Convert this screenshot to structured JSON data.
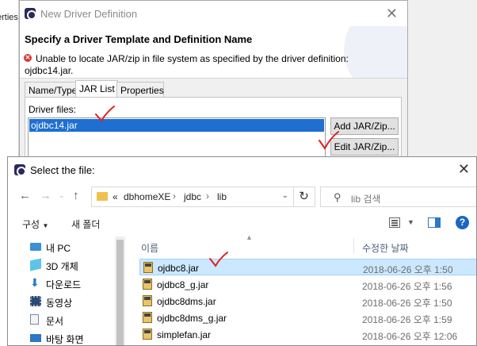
{
  "background": {
    "partial_text": "erties"
  },
  "driver_dialog": {
    "title": "New Driver Definition",
    "heading": "Specify a Driver Template and Definition Name",
    "error_line1": "Unable to locate JAR/zip in file system as specified by the driver definition:",
    "error_line2": "ojdbc14.jar.",
    "tabs": [
      {
        "label": "Name/Type"
      },
      {
        "label": "JAR List"
      },
      {
        "label": "Properties"
      }
    ],
    "driver_files_label": "Driver files:",
    "driver_files": [
      "ojdbc14.jar"
    ],
    "buttons": {
      "add": "Add JAR/Zip...",
      "edit": "Edit JAR/Zip..."
    }
  },
  "file_dialog": {
    "title": "Select the file:",
    "address": {
      "overflow": "«",
      "crumbs": [
        "dbhomeXE",
        "jdbc",
        "lib"
      ]
    },
    "search_placeholder": "lib 검색",
    "commands": {
      "organize": "구성",
      "new_folder": "새 폴더"
    },
    "nav_items": [
      {
        "label": "내 PC",
        "icon": "pc-icon"
      },
      {
        "label": "3D 개체",
        "icon": "cube-icon"
      },
      {
        "label": "다운로드",
        "icon": "download-icon"
      },
      {
        "label": "동영상",
        "icon": "video-icon"
      },
      {
        "label": "문서",
        "icon": "document-icon"
      },
      {
        "label": "바탕 화면",
        "icon": "desktop-icon"
      }
    ],
    "columns": {
      "name": "이름",
      "date": "수정한 날짜"
    },
    "files": [
      {
        "name": "ojdbc8.jar",
        "date": "2018-06-26 오후 1:50",
        "selected": true
      },
      {
        "name": "ojdbc8_g.jar",
        "date": "2018-06-26 오후 1:56",
        "selected": false
      },
      {
        "name": "ojdbc8dms.jar",
        "date": "2018-06-26 오후 1:50",
        "selected": false
      },
      {
        "name": "ojdbc8dms_g.jar",
        "date": "2018-06-26 오후 1:59",
        "selected": false
      },
      {
        "name": "simplefan.jar",
        "date": "2018-06-26 오후 12:06",
        "selected": false
      }
    ]
  },
  "colors": {
    "selection": "#1e6fd0",
    "file_selection": "#cce8ff",
    "annotation": "#e02020"
  }
}
